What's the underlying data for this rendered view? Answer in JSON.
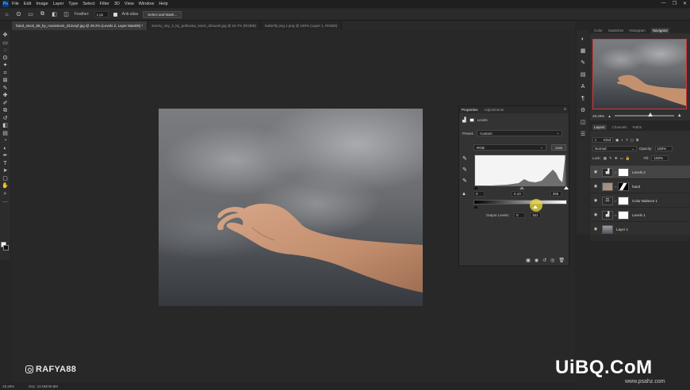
{
  "app": {
    "logo": "Ps",
    "menu": [
      "File",
      "Edit",
      "Image",
      "Layer",
      "Type",
      "Select",
      "Filter",
      "3D",
      "View",
      "Window",
      "Help"
    ],
    "window_controls": [
      "—",
      "❐",
      "✕"
    ]
  },
  "options_bar": {
    "feather_label": "Feather:",
    "feather_value": "1 px",
    "anti_alias_label": "Anti-alias",
    "select_mask_label": "Select and Mask..."
  },
  "doc_tabs": [
    "hand_stock_68_by_noxiestock_d13vvyf.jpg @ 29.2% (Levels 2, Layer Mask/8) *",
    "stormy_sky_3_by_pelkoraw_stock_d22uanl.jpg @ 16.7% (RGB/8)",
    "butterfly png 1.png @ 100% (Layer 1, RGB/8)"
  ],
  "tools": [
    "move-tool",
    "artboard-tool",
    "marquee-tool",
    "lasso-tool",
    "magic-wand-tool",
    "crop-tool",
    "frame-tool",
    "eyedropper-tool",
    "healing-tool",
    "brush-tool",
    "clone-stamp-tool",
    "history-brush-tool",
    "eraser-tool",
    "gradient-tool",
    "blur-tool",
    "dodge-tool",
    "pen-tool",
    "type-tool",
    "path-selection-tool",
    "shape-tool",
    "hand-tool",
    "zoom-tool",
    "more-tools"
  ],
  "tool_glyphs": [
    "✥",
    "▭",
    "◌",
    "ʘ",
    "✦",
    "⌗",
    "⊠",
    "✎",
    "✚",
    "✐",
    "⧉",
    "↺",
    "◧",
    "▤",
    "◔",
    "◐",
    "✒",
    "T",
    "➤",
    "▢",
    "✋",
    "⌕",
    "…"
  ],
  "properties": {
    "tabs": [
      "Properties",
      "Adjustments"
    ],
    "menu_glyph": "≡",
    "type_label": "Levels",
    "preset_label": "Preset:",
    "preset_value": "Custom",
    "channel_value": "RGB",
    "auto_label": "Auto",
    "input_black": "0",
    "input_mid": "0.10",
    "input_white": "255",
    "output_label": "Output Levels:",
    "output_black": "0",
    "output_white": "151",
    "bottom_glyphs": [
      "▣",
      "◉",
      "↺",
      "◎",
      "🗑"
    ]
  },
  "right_strip": [
    "◐",
    "▦",
    "✎",
    "▤",
    "A",
    "¶",
    "⚙",
    "◫",
    "☰"
  ],
  "navigator": {
    "tabs": [
      "Color",
      "Swatches",
      "Histogram",
      "Navigator"
    ],
    "zoom_value": "29.29%",
    "zoom_fraction": 0.6
  },
  "layers": {
    "tabs": [
      "Layers",
      "Channels",
      "Paths"
    ],
    "kind_label": "Kind",
    "blend_mode": "Normal",
    "opacity_label": "Opacity:",
    "opacity_value": "100%",
    "lock_label": "Lock:",
    "fill_label": "Fill:",
    "fill_value": "100%",
    "rows": [
      {
        "name": "Levels 2",
        "selected": true
      },
      {
        "name": "hand",
        "selected": false
      },
      {
        "name": "Color Balance 1",
        "selected": false
      },
      {
        "name": "Levels 1",
        "selected": false
      },
      {
        "name": "Layer 1",
        "selected": false
      }
    ]
  },
  "status": {
    "zoom": "29.29%",
    "doc": "Doc: 10.0M/49.8M"
  },
  "watermarks": {
    "instagram_handle": "RAFYA88",
    "uibq": "UiBQ.CoM",
    "psahz": "www.psahz.com"
  }
}
